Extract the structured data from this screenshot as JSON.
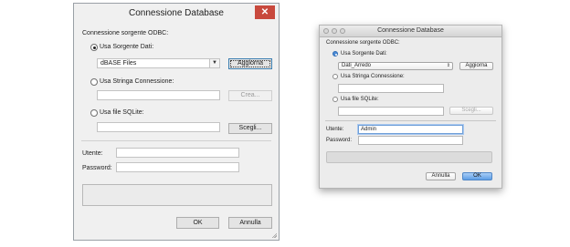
{
  "windows_dialog": {
    "title": "Connessione Database",
    "close_glyph": "✕",
    "section_label": "Connessione sorgente ODBC:",
    "radio_data_source": "Usa Sorgente Dati:",
    "data_source_value": "dBASE Files",
    "refresh_button": "Aggiorna",
    "radio_connection_string": "Usa Stringa Connessione:",
    "connection_string_value": "",
    "create_button": "Crea...",
    "radio_sqlite": "Usa file SQLite:",
    "sqlite_value": "",
    "choose_button": "Scegli...",
    "user_label": "Utente:",
    "user_value": "",
    "password_label": "Password:",
    "password_value": "",
    "ok_button": "OK",
    "cancel_button": "Annulla",
    "dropdown_arrow_glyph": "▼"
  },
  "mac_dialog": {
    "title": "Connessione Database",
    "section_label": "Connessione sorgente ODBC:",
    "radio_data_source": "Usa Sorgente Dati:",
    "data_source_value": "Dati_Arredo",
    "refresh_button": "Aggiorna",
    "radio_connection_string": "Usa Stringa Connessione:",
    "connection_string_value": "",
    "radio_sqlite": "Usa file SQLite:",
    "sqlite_value": "",
    "choose_button": "Scegli...",
    "user_label": "Utente:",
    "user_value": "Admin",
    "password_label": "Password:",
    "password_value": "",
    "cancel_button": "Annulla",
    "ok_button": "OK",
    "popup_arrow_glyph": "⇕"
  },
  "colors": {
    "windows_close": "#c8493d",
    "mac_default_button": "#5e9ee6",
    "mac_focus_ring": "#a9c8ef"
  }
}
